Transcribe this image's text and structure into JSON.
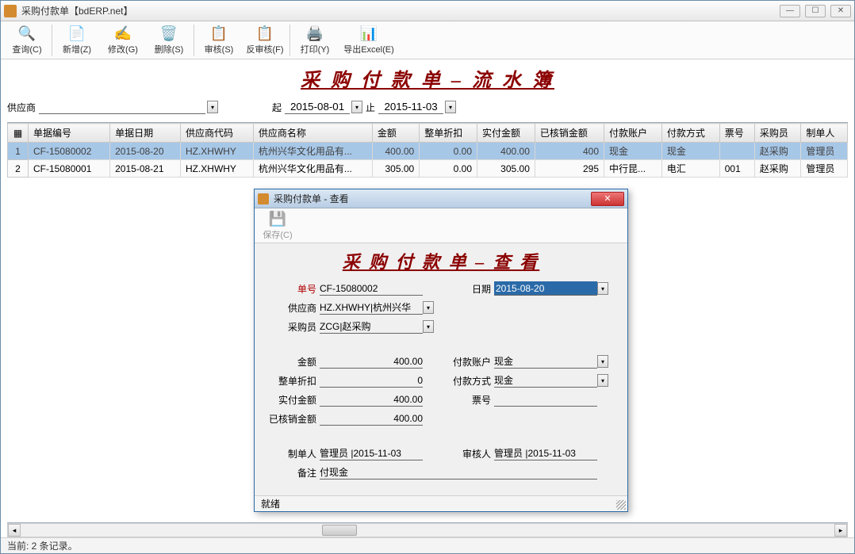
{
  "window": {
    "title": "采购付款单【bdERP.net】"
  },
  "toolbar": {
    "query": "查询(C)",
    "add": "新增(Z)",
    "edit": "修改(G)",
    "delete": "删除(S)",
    "audit": "审核(S)",
    "unaudit": "反审核(F)",
    "print": "打印(Y)",
    "export": "导出Excel(E)"
  },
  "page_title": "采 购 付 款 单 – 流 水 簿",
  "filter": {
    "supplier_label": "供应商",
    "start_label": "起",
    "start_date": "2015-08-01",
    "end_label": "止",
    "end_date": "2015-11-03"
  },
  "table": {
    "headers": {
      "doc_no": "单据编号",
      "doc_date": "单据日期",
      "supplier_code": "供应商代码",
      "supplier_name": "供应商名称",
      "amount": "金额",
      "discount": "整单折扣",
      "paid": "实付金额",
      "written_off": "已核销金额",
      "pay_account": "付款账户",
      "pay_method": "付款方式",
      "ticket": "票号",
      "buyer": "采购员",
      "creator": "制单人"
    },
    "rows": [
      {
        "n": "1",
        "doc_no": "CF-15080002",
        "doc_date": "2015-08-20",
        "supplier_code": "HZ.XHWHY",
        "supplier_name": "杭州兴华文化用品有...",
        "amount": "400.00",
        "discount": "0.00",
        "paid": "400.00",
        "written_off": "400",
        "pay_account": "现金",
        "pay_method": "现金",
        "ticket": "",
        "buyer": "赵采购",
        "creator": "管理员"
      },
      {
        "n": "2",
        "doc_no": "CF-15080001",
        "doc_date": "2015-08-21",
        "supplier_code": "HZ.XHWHY",
        "supplier_name": "杭州兴华文化用品有...",
        "amount": "305.00",
        "discount": "0.00",
        "paid": "305.00",
        "written_off": "295",
        "pay_account": "中行昆...",
        "pay_method": "电汇",
        "ticket": "001",
        "buyer": "赵采购",
        "creator": "管理员"
      }
    ]
  },
  "statusbar": "当前: 2 条记录。",
  "dialog": {
    "title": "采购付款单 - 查看",
    "save_label": "保存(C)",
    "page_title": "采 购 付 款 单 – 查 看",
    "labels": {
      "doc_no": "单号",
      "date": "日期",
      "supplier": "供应商",
      "buyer": "采购员",
      "amount": "金额",
      "pay_account": "付款账户",
      "discount": "整单折扣",
      "pay_method": "付款方式",
      "paid": "实付金额",
      "ticket": "票号",
      "written_off": "已核销金额",
      "creator": "制单人",
      "auditor": "审核人",
      "remark": "备注"
    },
    "values": {
      "doc_no": "CF-15080002",
      "date": "2015-08-20",
      "supplier": "HZ.XHWHY|杭州兴华",
      "buyer": "ZCG|赵采购",
      "amount": "400.00",
      "pay_account": "现金",
      "discount": "0",
      "pay_method": "现金",
      "paid": "400.00",
      "ticket": "",
      "written_off": "400.00",
      "creator": "管理员 |2015-11-03",
      "auditor": "管理员 |2015-11-03",
      "remark": "付现金"
    },
    "status": "就绪"
  }
}
